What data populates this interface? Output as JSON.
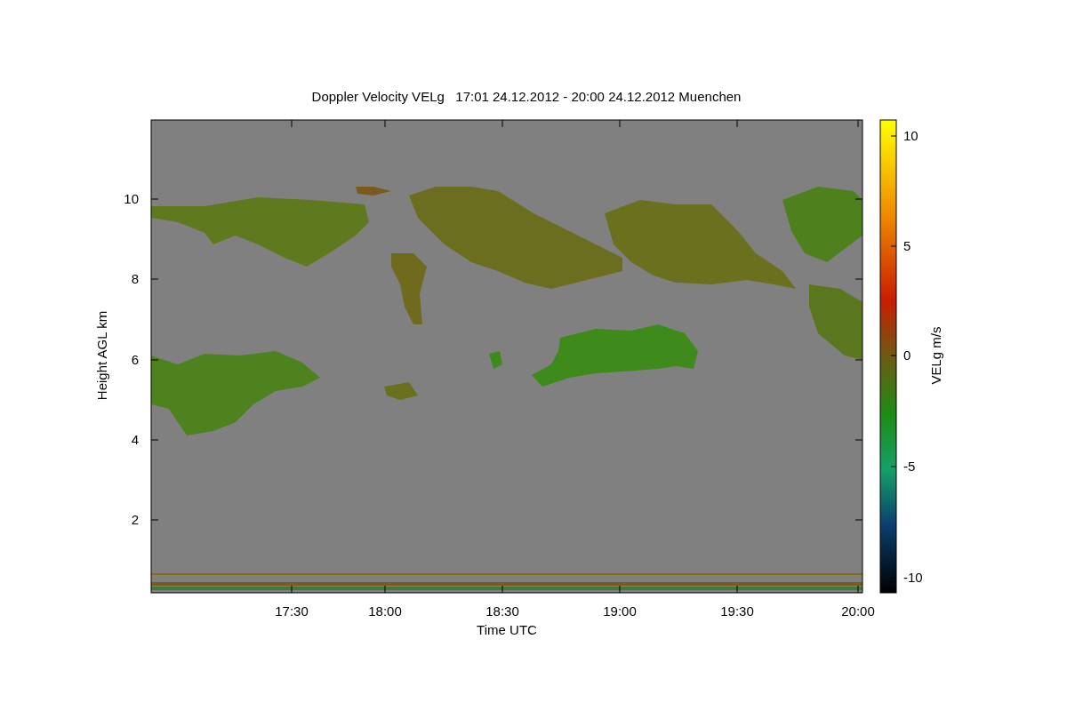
{
  "title": "Doppler Velocity VELg   17:01 24.12.2012 - 20:00 24.12.2012 Muenchen",
  "plot": {
    "xlabel": "Time UTC",
    "ylabel": "Height AGL km",
    "xticks": [
      "17:30",
      "18:00",
      "18:30",
      "19:00",
      "19:30",
      "20:00"
    ],
    "yticks": [
      "10",
      "8",
      "6",
      "4",
      "2"
    ]
  },
  "colorbar": {
    "label": "VELg m/s",
    "ticks": [
      "10",
      "5",
      "0",
      "-5",
      "-10"
    ]
  }
}
